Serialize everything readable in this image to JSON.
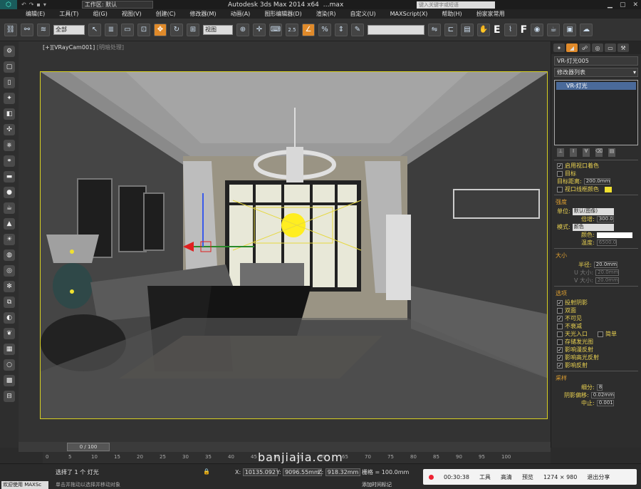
{
  "titlebar": {
    "workspace": "工作区: 默认",
    "app_title": "Autodesk 3ds Max  2014 x64",
    "file": "…max",
    "search_placeholder": "键入关键字或短语",
    "quick_access": [
      "↶",
      "↷",
      "▪",
      "▾"
    ]
  },
  "menu": [
    "编辑(E)",
    "工具(T)",
    "组(G)",
    "视图(V)",
    "创建(C)",
    "修改器(M)",
    "动画(A)",
    "图形编辑器(D)",
    "渲染(R)",
    "自定义(U)",
    "MAXScript(X)",
    "帮助(H)",
    "扮家家常用"
  ],
  "toolbar": {
    "filter": "全部",
    "view": "视图",
    "snap_num": "2.5",
    "named_sel": "",
    "letters": [
      "E",
      "F"
    ]
  },
  "viewport": {
    "label_prefix": "[+]",
    "camera": "[VRayCam001]",
    "mode": "[明暗处理]"
  },
  "panel": {
    "object_name": "VR-灯光005",
    "modifier_list": "修改器列表",
    "stack_item": "VR-灯光",
    "general": {
      "enable_viewport_shading": "启用视口着色",
      "target": "目标",
      "target_distance_label": "目标距离:",
      "target_distance": "200.0mm",
      "viewport_wire_color": "视口线框颜色"
    },
    "intensity": {
      "title": "强度",
      "unit_label": "单位:",
      "unit_value": "默认(图像)",
      "multiplier_label": "倍增:",
      "multiplier": "300.0",
      "mode_label": "模式:",
      "mode_value": "颜色",
      "color_label": "颜色:",
      "temp_label": "温度:",
      "temp": "6500.0"
    },
    "size": {
      "title": "大小",
      "radius_label": "半径:",
      "radius": "20.0mm",
      "u_label": "U 大小:",
      "u_value": "20.0mm",
      "v_label": "V 大小:",
      "v_value": "20.0mm"
    },
    "options": {
      "title": "选项",
      "items": [
        {
          "label": "投射阴影",
          "checked": true
        },
        {
          "label": "双面",
          "checked": false
        },
        {
          "label": "不可见",
          "checked": true
        },
        {
          "label": "不衰减",
          "checked": false
        },
        {
          "label": "天光入口",
          "checked": false
        },
        {
          "label": "存储发光图",
          "checked": false
        },
        {
          "label": "影响漫反射",
          "checked": true
        },
        {
          "label": "影响高光反射",
          "checked": true
        },
        {
          "label": "影响反射",
          "checked": true
        }
      ],
      "simple": "简单"
    },
    "sampling": {
      "title": "采样",
      "subdivs_label": "细分:",
      "subdivs": "8",
      "shadow_bias_label": "阴影偏移:",
      "shadow_bias": "0.02mm",
      "cutoff_label": "中止:",
      "cutoff": "0.001"
    }
  },
  "timeslider": {
    "frame": "0 / 100",
    "ticks": [
      "0",
      "5",
      "10",
      "15",
      "20",
      "25",
      "30",
      "35",
      "40",
      "45",
      "50",
      "55",
      "60",
      "65",
      "70",
      "75",
      "80",
      "85",
      "90",
      "95",
      "100"
    ]
  },
  "status": {
    "selected": "选择了 1 个 灯光",
    "hint": "单击并拖动以选择并移动对象",
    "welcome": "欢迎使用 MAXSc",
    "x_label": "X:",
    "x": "10135.092",
    "y_label": "Y:",
    "y": "9096.55mm",
    "z_label": "Z:",
    "z": "918.32mm",
    "grid": "栅格 = 100.0mm",
    "add_time_tag": "添加时间标记"
  },
  "watermark": "banjiajia.com",
  "recorder": {
    "time": "00:30:38",
    "tools": "工具",
    "quality": "高清",
    "preview": "预览",
    "resolution": "1274 × 980",
    "exit": "退出分享"
  },
  "colors": {
    "accent": "#e08a2a",
    "viewport_border": "#d8d020",
    "wire_color": "#f0e030"
  }
}
